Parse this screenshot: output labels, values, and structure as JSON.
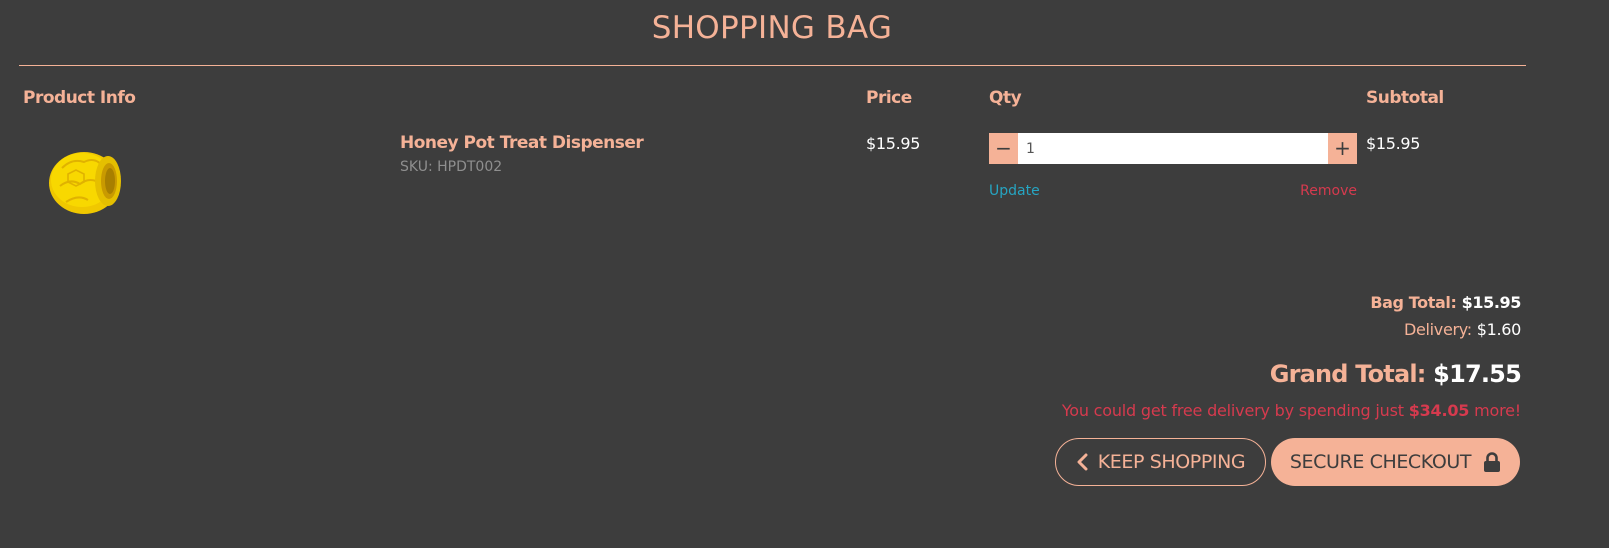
{
  "page": {
    "title": "SHOPPING BAG"
  },
  "columns": {
    "product_info": "Product Info",
    "price": "Price",
    "qty": "Qty",
    "subtotal": "Subtotal"
  },
  "items": [
    {
      "name": "Honey Pot Treat Dispenser",
      "sku": "SKU: HPDT002",
      "price": "$15.95",
      "qty": "1",
      "subtotal": "$15.95",
      "image_icon": "honey-pot-toy-image",
      "decrease_symbol": "−",
      "increase_symbol": "+",
      "update_label": "Update",
      "remove_label": "Remove"
    }
  ],
  "totals": {
    "bag_total_label": "Bag Total:",
    "bag_total_value": "$15.95",
    "delivery_label": "Delivery:",
    "delivery_value": "$1.60",
    "grand_total_label": "Grand Total:",
    "grand_total_value": "$17.55",
    "free_delivery_prefix": "You could get free delivery by spending just",
    "free_delivery_amount": "$34.05",
    "free_delivery_suffix": "more!"
  },
  "actions": {
    "keep_shopping_label": "KEEP SHOPPING",
    "keep_shopping_icon": "chevron-left-icon",
    "checkout_label": "SECURE CHECKOUT",
    "checkout_icon": "lock-icon"
  },
  "colors": {
    "background": "#3d3d3d",
    "accent": "#f5b297",
    "update_link": "#26a5c2",
    "remove_link": "#d63a4e",
    "product_image": "#f5d400"
  }
}
